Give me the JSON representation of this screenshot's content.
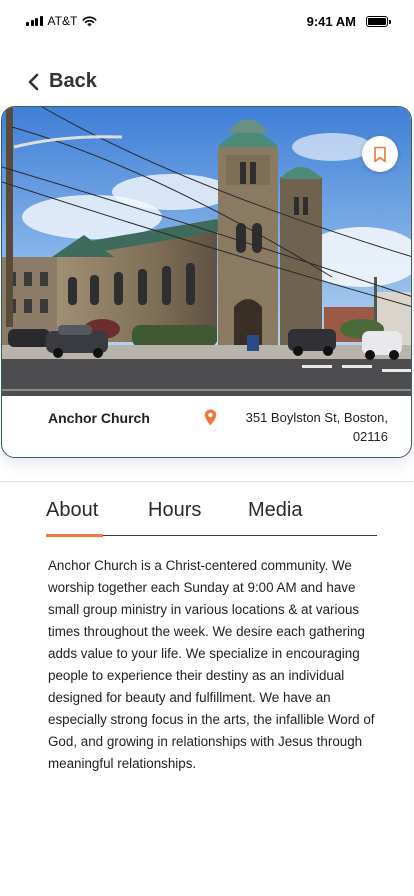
{
  "status_bar": {
    "carrier": "AT&T",
    "time": "9:41 AM"
  },
  "nav": {
    "back_label": "Back"
  },
  "church": {
    "name": "Anchor Church",
    "address": "351 Boylston St, Boston, 02116"
  },
  "tabs": [
    {
      "label": "About",
      "active": true
    },
    {
      "label": "Hours",
      "active": false
    },
    {
      "label": "Media",
      "active": false
    }
  ],
  "about_text": "Anchor Church is a Christ-centered community. We worship together each Sunday at 9:00 AM and have small group ministry in various locations & at various times throughout the week.  We desire each gathering adds value to your life. We specialize in encouraging people to experience their destiny as an individual designed for beauty and fulfillment. We have an especially strong focus in the arts, the infallible Word of God, and growing in relationships with Jesus through meaningful relationships.",
  "colors": {
    "accent": "#f2763b",
    "card_border": "#3d5f5a",
    "text": "#222222"
  },
  "icons": [
    "chevron-left-icon",
    "bookmark-icon",
    "location-pin-icon",
    "wifi-icon",
    "signal-icon",
    "battery-icon"
  ]
}
